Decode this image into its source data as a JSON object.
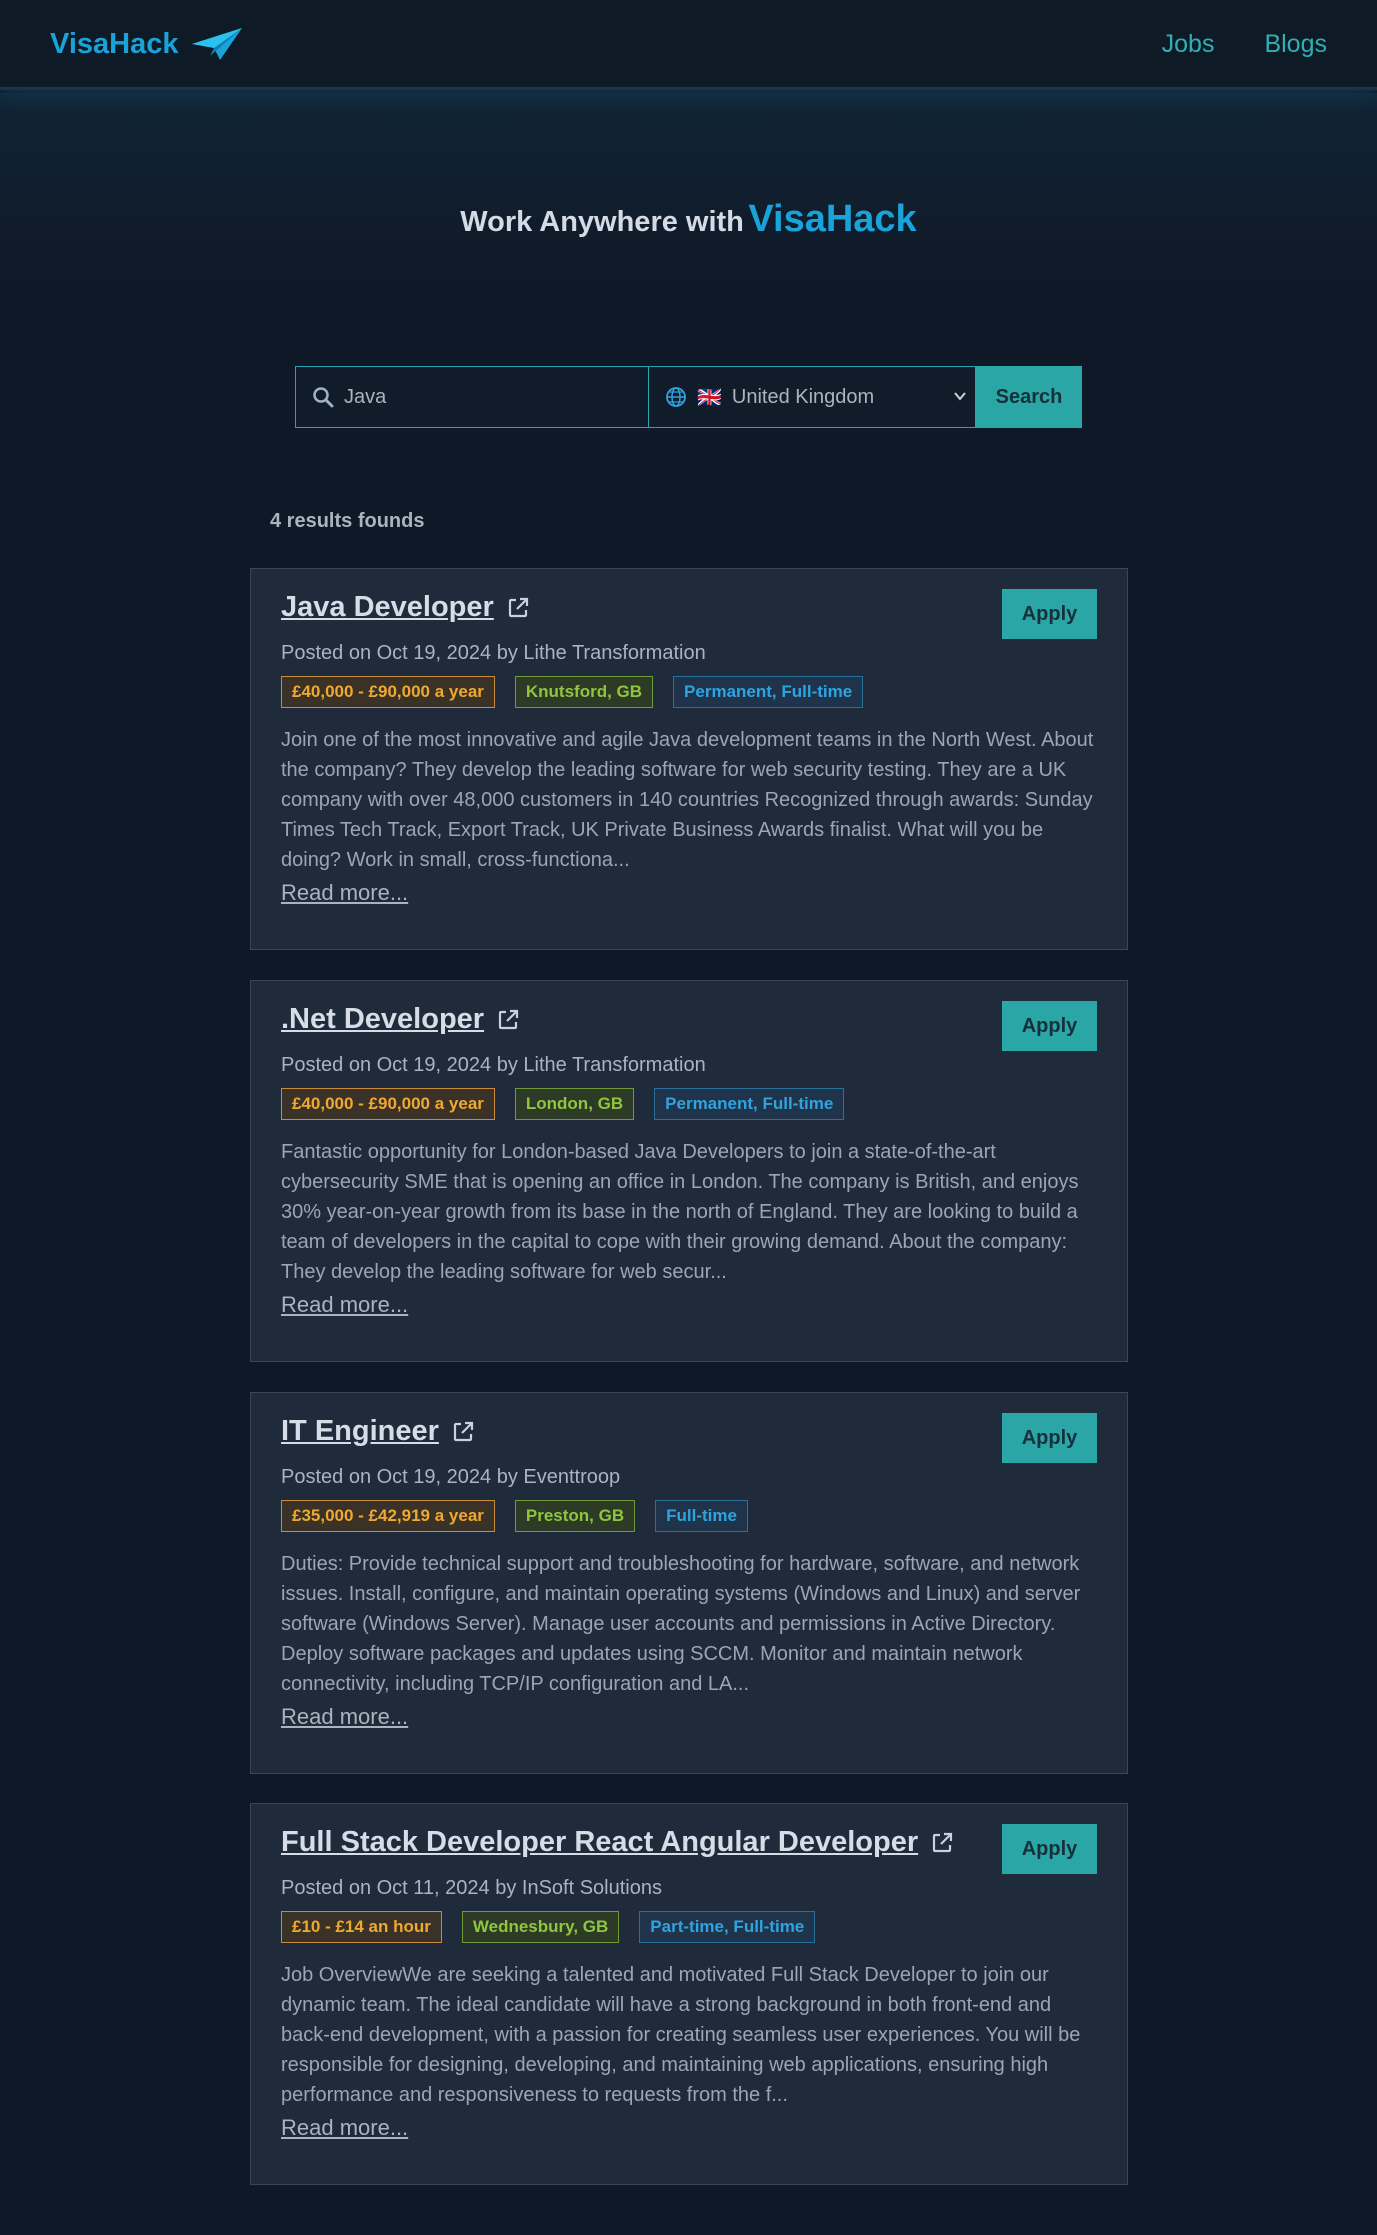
{
  "header": {
    "brand": "VisaHack",
    "nav": [
      {
        "label": "Jobs"
      },
      {
        "label": "Blogs"
      }
    ]
  },
  "hero": {
    "lead": "Work Anywhere with",
    "brand": "VisaHack"
  },
  "search": {
    "query": "Java",
    "country_flag": "🇬🇧",
    "country": "United Kingdom",
    "button": "Search"
  },
  "results": {
    "count_text": "4 results founds"
  },
  "jobs": [
    {
      "title": "Java Developer",
      "posted": "Posted on Oct 19, 2024 by Lithe Transformation",
      "salary": "£40,000 - £90,000 a year",
      "location": "Knutsford, GB",
      "type": "Permanent, Full-time",
      "description": "Join one of the most innovative and agile Java development teams in the North West. About the company? They develop the leading software for web security testing. They are a UK company with over 48,000 customers in 140 countries Recognized through awards: Sunday Times Tech Track, Export Track, UK Private Business Awards finalist. What will you be doing? Work in small, cross-functiona...",
      "read_more": "Read more...",
      "apply": "Apply"
    },
    {
      "title": ".Net Developer",
      "posted": "Posted on Oct 19, 2024 by Lithe Transformation",
      "salary": "£40,000 - £90,000 a year",
      "location": "London, GB",
      "type": "Permanent, Full-time",
      "description": "Fantastic opportunity for London-based Java Developers to join a state-of-the-art cybersecurity SME that is opening an office in London. The company is British, and enjoys 30% year-on-year growth from its base in the north of England. They are looking to build a team of developers in the capital to cope with their growing demand. About the company: They develop the leading software for web secur...",
      "read_more": "Read more...",
      "apply": "Apply"
    },
    {
      "title": "IT Engineer",
      "posted": "Posted on Oct 19, 2024 by Eventtroop",
      "salary": "£35,000 - £42,919 a year",
      "location": "Preston, GB",
      "type": "Full-time",
      "description": "Duties: Provide technical support and troubleshooting for hardware, software, and network issues. Install, configure, and maintain operating systems (Windows and Linux) and server software (Windows Server). Manage user accounts and permissions in Active Directory. Deploy software packages and updates using SCCM. Monitor and maintain network connectivity, including TCP/IP configuration and LA...",
      "read_more": "Read more...",
      "apply": "Apply"
    },
    {
      "title": "Full Stack Developer React Angular Developer",
      "posted": "Posted on Oct 11, 2024 by InSoft Solutions",
      "salary": "£10 - £14 an hour",
      "location": "Wednesbury, GB",
      "type": "Part-time, Full-time",
      "description": "Job OverviewWe are seeking a talented and motivated Full Stack Developer to join our dynamic team. The ideal candidate will have a strong background in both front-end and back-end development, with a passion for creating seamless user experiences. You will be responsible for designing, developing, and maintaining web applications, ensuring high performance and responsiveness to requests from the f...",
      "read_more": "Read more...",
      "apply": "Apply"
    }
  ]
}
